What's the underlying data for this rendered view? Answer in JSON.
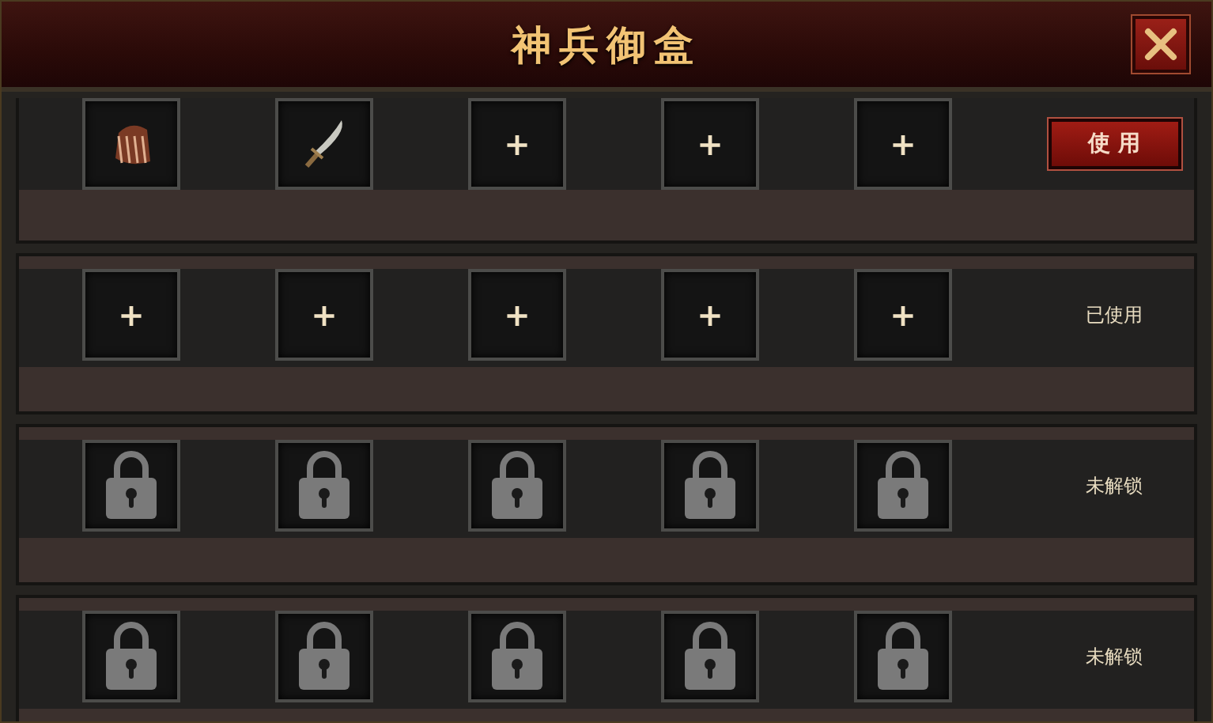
{
  "window": {
    "title": "神兵御盒"
  },
  "rows": [
    {
      "slots": [
        {
          "kind": "claw"
        },
        {
          "kind": "blade"
        },
        {
          "kind": "empty",
          "label": "+"
        },
        {
          "kind": "empty",
          "label": "+"
        },
        {
          "kind": "empty",
          "label": "+"
        }
      ],
      "action": {
        "kind": "button",
        "label": "使 用"
      }
    },
    {
      "slots": [
        {
          "kind": "empty",
          "label": "+"
        },
        {
          "kind": "empty",
          "label": "+"
        },
        {
          "kind": "empty",
          "label": "+"
        },
        {
          "kind": "empty",
          "label": "+"
        },
        {
          "kind": "empty",
          "label": "+"
        }
      ],
      "action": {
        "kind": "status",
        "label": "已使用"
      }
    },
    {
      "slots": [
        {
          "kind": "locked"
        },
        {
          "kind": "locked"
        },
        {
          "kind": "locked"
        },
        {
          "kind": "locked"
        },
        {
          "kind": "locked"
        }
      ],
      "action": {
        "kind": "status",
        "label": "未解锁"
      }
    },
    {
      "slots": [
        {
          "kind": "locked"
        },
        {
          "kind": "locked"
        },
        {
          "kind": "locked"
        },
        {
          "kind": "locked"
        },
        {
          "kind": "locked"
        }
      ],
      "action": {
        "kind": "status",
        "label": "未解锁"
      }
    }
  ]
}
